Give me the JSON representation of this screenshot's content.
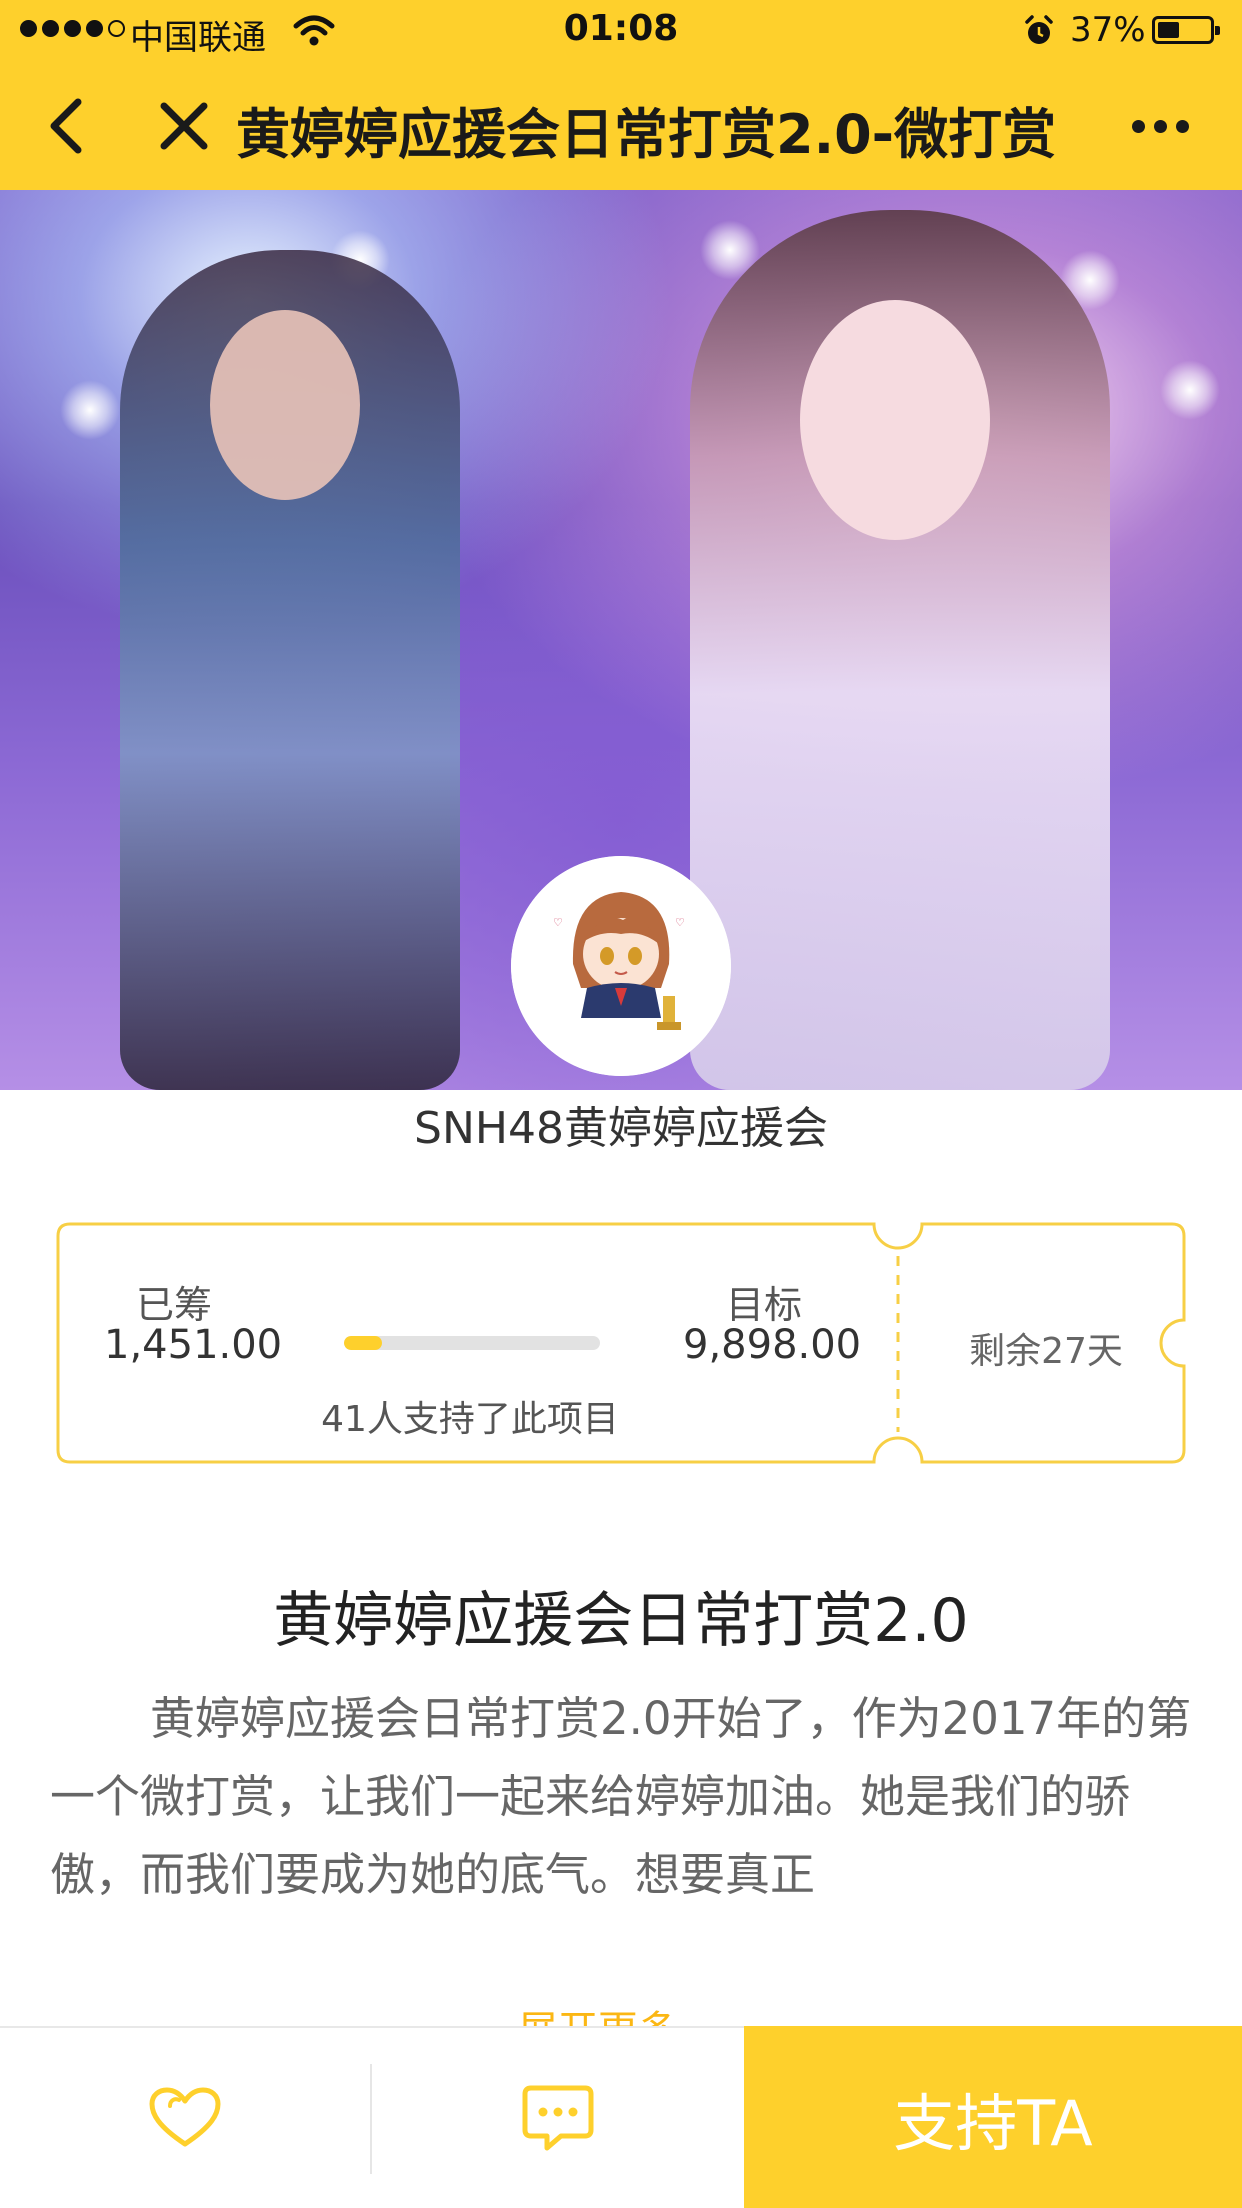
{
  "status_bar": {
    "carrier": "中国联通",
    "time": "01:08",
    "battery_percent": "37%",
    "battery_level": 0.37,
    "signal_bars_filled": 4,
    "signal_bars_total": 5
  },
  "nav": {
    "title": "黄婷婷应援会日常打赏2.0-微打赏"
  },
  "project": {
    "org_name": "SNH48黄婷婷应援会",
    "raised_label": "已筹",
    "raised_value": "1,451.00",
    "goal_label": "目标",
    "goal_value": "9,898.00",
    "progress_fraction": 0.147,
    "supporters_text": "41人支持了此项目",
    "remaining_text": "剩余27天"
  },
  "description": {
    "title": "黄婷婷应援会日常打赏2.0",
    "body": "黄婷婷应援会日常打赏2.0开始了，作为2017年的第一个微打赏，让我们一起来给婷婷加油。她是我们的骄傲，而我们要成为她的底气。想要真正",
    "expand_label": "展开更多"
  },
  "bottom_bar": {
    "support_label": "支持TA"
  },
  "colors": {
    "brand_yellow": "#fed02c",
    "expand_orange": "#fbb714"
  }
}
